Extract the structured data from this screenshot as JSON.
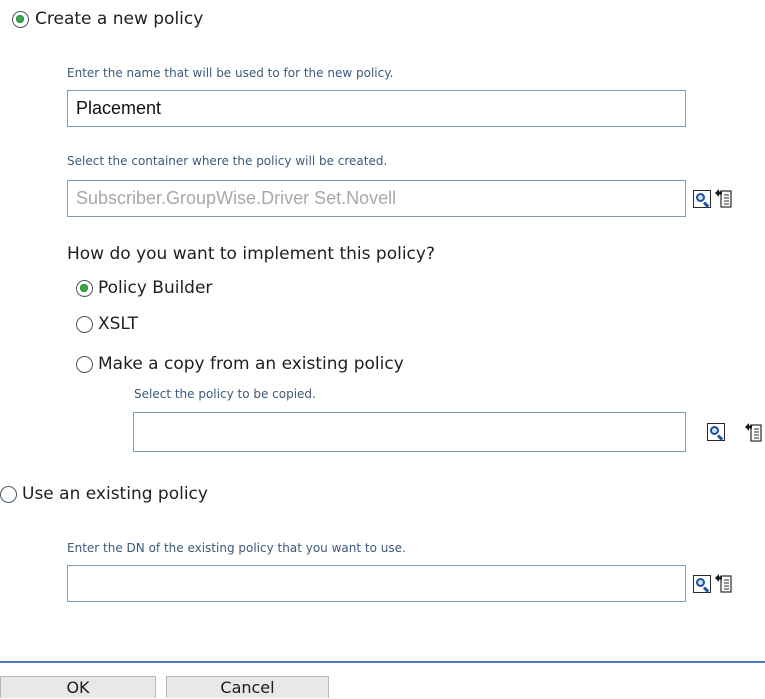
{
  "create_new": {
    "radio_label": "Create a new policy",
    "name_hint": "Enter the name that will be used to for the new policy.",
    "name_value": "Placement",
    "container_hint": "Select the container where the policy will be created.",
    "container_value": "Subscriber.GroupWise.Driver Set.Novell",
    "implement_question": "How do you want to implement this policy?",
    "options": [
      {
        "label": "Policy Builder",
        "selected": true
      },
      {
        "label": "XSLT",
        "selected": false
      },
      {
        "label": "Make a copy from an existing policy",
        "selected": false
      }
    ],
    "copy_hint": "Select the policy to be copied.",
    "copy_value": ""
  },
  "use_existing": {
    "radio_label": "Use an existing policy",
    "dn_hint": "Enter the DN of the existing policy that you want to use.",
    "dn_value": ""
  },
  "buttons": {
    "ok": "OK",
    "cancel": "Cancel"
  },
  "icons": {
    "search": "search-icon",
    "browse": "browse-tree-icon"
  },
  "colors": {
    "accent_rule": "#4a7ab5",
    "hint_text": "#3d5a7a",
    "radio_checked": "#3aa84a"
  }
}
